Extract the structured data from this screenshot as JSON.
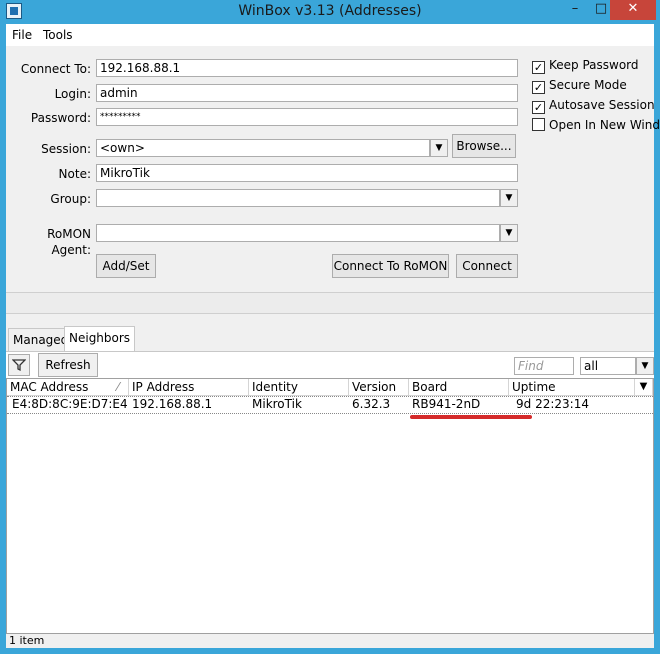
{
  "window": {
    "title": "WinBox v3.13 (Addresses)",
    "minimize": "–",
    "maximize": "□",
    "close": "✕"
  },
  "menu": {
    "file": "File",
    "tools": "Tools"
  },
  "form": {
    "connect_to_label": "Connect To:",
    "connect_to_value": "192.168.88.1",
    "login_label": "Login:",
    "login_value": "admin",
    "password_label": "Password:",
    "password_value": "*********",
    "session_label": "Session:",
    "session_value": "<own>",
    "browse_label": "Browse...",
    "note_label": "Note:",
    "note_value": "MikroTik",
    "group_label": "Group:",
    "group_value": "",
    "romon_label": "RoMON Agent:",
    "romon_value": "",
    "addset_label": "Add/Set",
    "connect_romon_label": "Connect To RoMON",
    "connect_label": "Connect"
  },
  "options": [
    {
      "label": "Keep Password",
      "checked": true
    },
    {
      "label": "Secure Mode",
      "checked": true
    },
    {
      "label": "Autosave Session",
      "checked": true
    },
    {
      "label": "Open In New Window",
      "checked": false
    }
  ],
  "tabs": {
    "managed": "Managed",
    "neighbors": "Neighbors"
  },
  "toolbar": {
    "refresh_label": "Refresh",
    "find_placeholder": "Find",
    "filter_value": "all"
  },
  "table": {
    "columns": [
      "MAC Address",
      "IP Address",
      "Identity",
      "Version",
      "Board",
      "Uptime"
    ],
    "rows": [
      {
        "mac": "E4:8D:8C:9E:D7:E4",
        "ip": "192.168.88.1",
        "identity": "MikroTik",
        "version": "6.32.3",
        "board": "RB941-2nD",
        "uptime": "9d 22:23:14"
      }
    ]
  },
  "status": {
    "count": "1 item"
  },
  "colors": {
    "titlebar": "#3aa6d9",
    "close_button": "#c7453a",
    "highlight_underline": "#d42a2a"
  }
}
